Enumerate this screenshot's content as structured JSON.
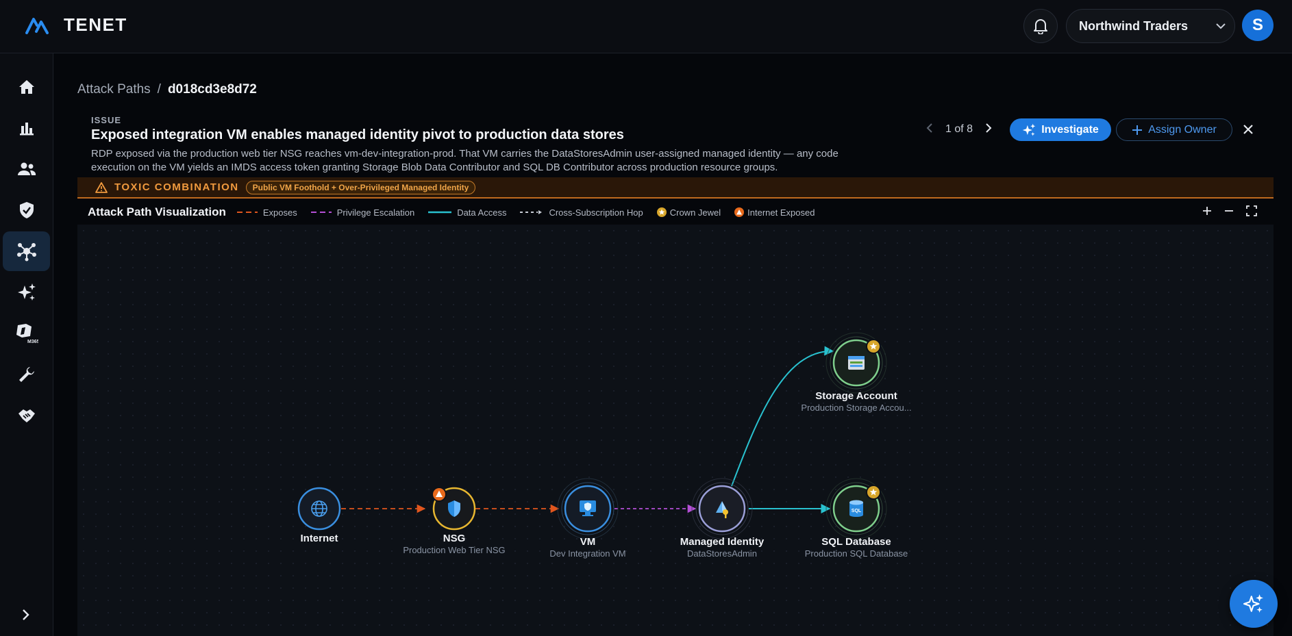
{
  "app": {
    "brand": "TENET",
    "org_name": "Northwind Traders",
    "user_initial": "S"
  },
  "colors": {
    "accent": "#1f7ae0",
    "exposes": "#e0561e",
    "escalation": "#b44fd6",
    "data_access": "#29c1cf",
    "hop": "#c9ced7",
    "crown": "#d8a62a",
    "internet": "#e86a1c"
  },
  "sidebar": {
    "items": [
      {
        "icon": "home-icon"
      },
      {
        "icon": "bar-chart-icon"
      },
      {
        "icon": "users-icon"
      },
      {
        "icon": "shield-check-icon"
      },
      {
        "icon": "attack-graph-icon",
        "active": true
      },
      {
        "icon": "sparkles-icon"
      },
      {
        "icon": "m365-icon",
        "badge": "M365"
      },
      {
        "icon": "wrench-icon"
      },
      {
        "icon": "handshake-icon"
      }
    ]
  },
  "breadcrumb": {
    "parent": "Attack Paths",
    "separator": "/",
    "current": "d018cd3e8d72"
  },
  "issue": {
    "label": "ISSUE",
    "title": "Exposed integration VM enables managed identity pivot to production data stores",
    "description": "RDP exposed via the production web tier NSG reaches vm-dev-integration-prod. That VM carries the DataStoresAdmin user-assigned managed identity — any code execution on the VM yields an IMDS access token granting Storage Blob Data Contributor and SQL DB Contributor across production resource groups."
  },
  "pager": {
    "text": "1 of 8"
  },
  "actions": {
    "investigate": "Investigate",
    "assign_owner": "Assign Owner"
  },
  "toxic": {
    "label": "TOXIC COMBINATION",
    "pill": "Public VM Foothold + Over-Privileged Managed Identity"
  },
  "viz": {
    "title": "Attack Path Visualization",
    "legend": {
      "exposes": "Exposes",
      "escalation": "Privilege Escalation",
      "data_access": "Data Access",
      "hop": "Cross-Subscription Hop",
      "crown": "Crown Jewel",
      "internet": "Internet Exposed"
    }
  },
  "nodes": {
    "internet": {
      "name": "Internet",
      "sub": ""
    },
    "nsg": {
      "name": "NSG",
      "sub": "Production Web Tier NSG"
    },
    "vm": {
      "name": "VM",
      "sub": "Dev Integration VM"
    },
    "identity": {
      "name": "Managed Identity",
      "sub": "DataStoresAdmin"
    },
    "storage": {
      "name": "Storage Account",
      "sub": "Production Storage Accou..."
    },
    "sql": {
      "name": "SQL Database",
      "sub": "Production SQL Database",
      "icon_text": "SQL"
    }
  }
}
